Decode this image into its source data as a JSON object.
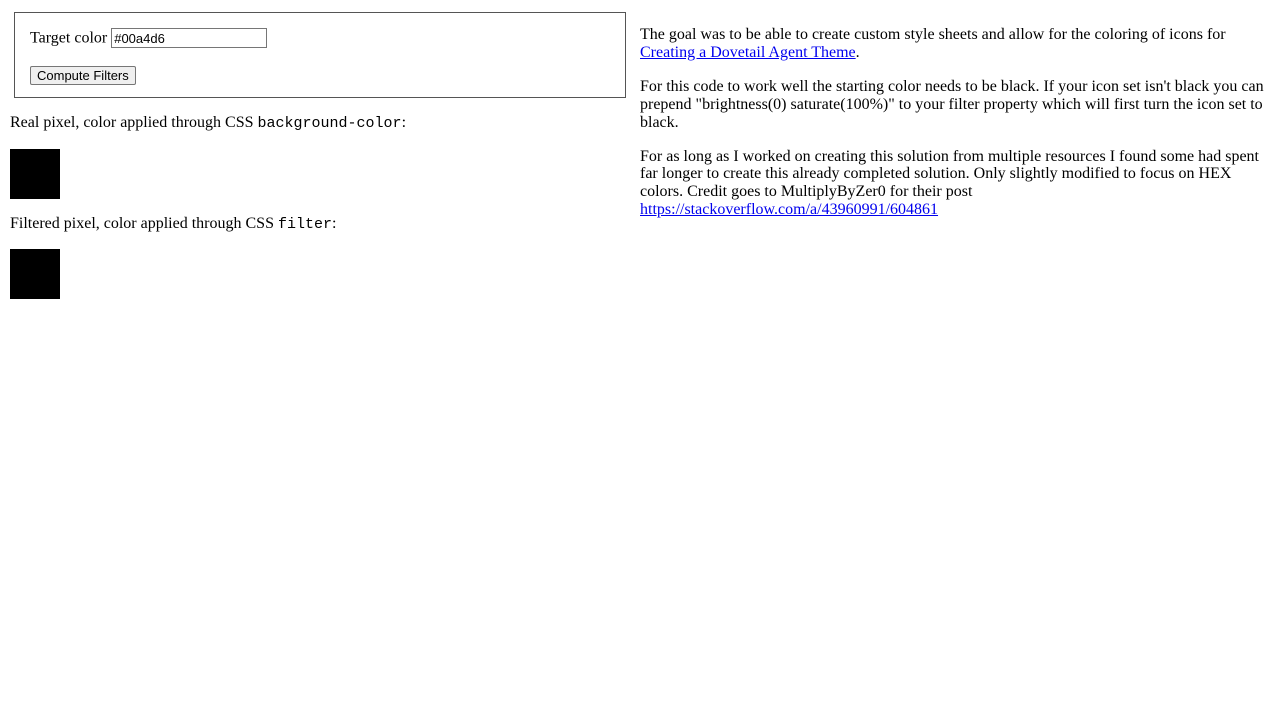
{
  "form": {
    "label": "Target color",
    "input_value": "#00a4d6",
    "button_label": "Compute Filters"
  },
  "left": {
    "real_pixel_prefix": "Real pixel, color applied through CSS ",
    "real_pixel_code": "background-color",
    "real_pixel_suffix": ":",
    "filtered_pixel_prefix": "Filtered pixel, color applied through CSS ",
    "filtered_pixel_code": "filter",
    "filtered_pixel_suffix": ":"
  },
  "right": {
    "p1_prefix": "The goal was to be able to create custom style sheets and allow for the coloring of icons for ",
    "p1_link": "Creating a Dovetail Agent Theme",
    "p1_suffix": ".",
    "p2": "For this code to work well the starting color needs to be black. If your icon set isn't black you can prepend \"brightness(0) saturate(100%)\" to your filter property which will first turn the icon set to black.",
    "p3_prefix": "For as long as I worked on creating this solution from multiple resources I found some had spent far longer to create this already completed solution. Only slightly modified to focus on HEX colors. Credit goes to MultiplyByZer0 for their post ",
    "p3_link": "https://stackoverflow.com/a/43960991/604861"
  },
  "colors": {
    "swatch": "#000000",
    "link": "#0000ee"
  }
}
